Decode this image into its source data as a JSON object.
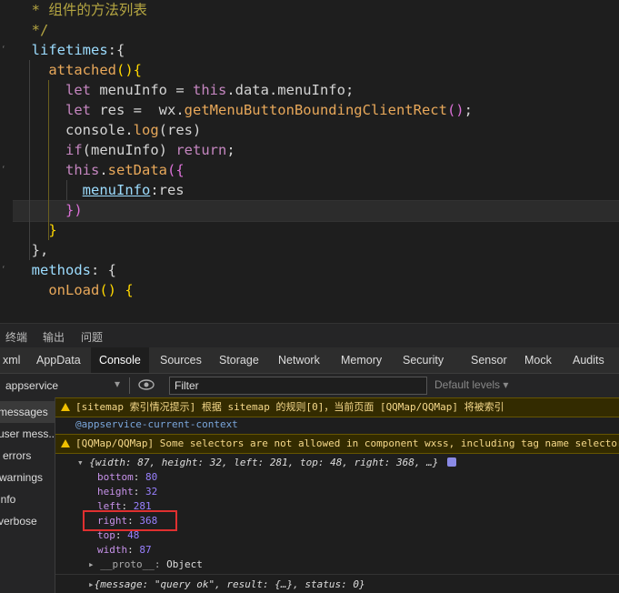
{
  "code": {
    "lines": [
      {
        "indent": "  ",
        "tokens": [
          {
            "t": "* 组件的方法列表",
            "c": "c-com"
          }
        ]
      },
      {
        "indent": "  ",
        "tokens": [
          {
            "t": "*/",
            "c": "c-com"
          }
        ]
      },
      {
        "indent": "  ",
        "tokens": [
          {
            "t": "lifetimes",
            "c": "c-prop"
          },
          {
            "t": ":{",
            "c": "c-plain"
          }
        ]
      },
      {
        "indent": "    ",
        "tokens": [
          {
            "t": "attached",
            "c": "c-or"
          },
          {
            "t": "(){",
            "c": "c-yel"
          }
        ]
      },
      {
        "indent": "      ",
        "tokens": [
          {
            "t": "let ",
            "c": "c-kw"
          },
          {
            "t": "menuInfo",
            "c": "c-plain"
          },
          {
            "t": " = ",
            "c": "c-plain"
          },
          {
            "t": "this",
            "c": "c-kw"
          },
          {
            "t": ".data.menuInfo;",
            "c": "c-plain"
          }
        ]
      },
      {
        "indent": "      ",
        "tokens": [
          {
            "t": "let ",
            "c": "c-kw"
          },
          {
            "t": "res",
            "c": "c-plain"
          },
          {
            "t": " =  wx.",
            "c": "c-plain"
          },
          {
            "t": "getMenuButtonBoundingClientRect",
            "c": "c-or"
          },
          {
            "t": "()",
            "c": "c-pink"
          },
          {
            "t": ";",
            "c": "c-plain"
          }
        ]
      },
      {
        "indent": "      ",
        "tokens": [
          {
            "t": "console.",
            "c": "c-plain"
          },
          {
            "t": "log",
            "c": "c-or"
          },
          {
            "t": "(res)",
            "c": "c-plain"
          }
        ]
      },
      {
        "indent": "      ",
        "tokens": [
          {
            "t": "if",
            "c": "c-kw"
          },
          {
            "t": "(menuInfo) ",
            "c": "c-plain"
          },
          {
            "t": "return",
            "c": "c-kw"
          },
          {
            "t": ";",
            "c": "c-plain"
          }
        ]
      },
      {
        "indent": "      ",
        "tokens": [
          {
            "t": "this",
            "c": "c-kw"
          },
          {
            "t": ".",
            "c": "c-plain"
          },
          {
            "t": "setData",
            "c": "c-or"
          },
          {
            "t": "({",
            "c": "c-pink"
          }
        ]
      },
      {
        "indent": "        ",
        "tokens": [
          {
            "t": "menuInfo",
            "c": "c-ul"
          },
          {
            "t": ":res",
            "c": "c-plain"
          }
        ]
      },
      {
        "indent": "      ",
        "tokens": [
          {
            "t": "})",
            "c": "c-pink"
          }
        ]
      },
      {
        "indent": "    ",
        "tokens": [
          {
            "t": "}",
            "c": "c-yel"
          }
        ]
      },
      {
        "indent": "  ",
        "tokens": [
          {
            "t": "},",
            "c": "c-plain"
          }
        ]
      },
      {
        "indent": "  ",
        "tokens": [
          {
            "t": "methods",
            "c": "c-prop"
          },
          {
            "t": ": {",
            "c": "c-plain"
          }
        ]
      },
      {
        "indent": "    ",
        "tokens": [
          {
            "t": "onLoad",
            "c": "c-or"
          },
          {
            "t": "() {",
            "c": "c-yel"
          }
        ]
      }
    ]
  },
  "panel": {
    "tab1": "终端",
    "tab2": "输出",
    "tab3": "问题"
  },
  "devtools": {
    "tabs": [
      "xml",
      "AppData",
      "Console",
      "Sources",
      "Storage",
      "Network",
      "Memory",
      "Security",
      "Sensor",
      "Mock",
      "Audits"
    ],
    "active_tab": "Console",
    "context": "appservice",
    "filter_placeholder": "Filter",
    "levels": "Default levels"
  },
  "sidebar": [
    "messages",
    "user mess...",
    "errors",
    "warnings",
    "info",
    "verbose"
  ],
  "console": {
    "warn1": "[sitemap 索引情况提示] 根据 sitemap 的规则[0]，当前页面 [QQMap/QQMap] 将被索引",
    "context_link": "@appservice-current-context",
    "warn2": "[QQMap/QQMap] Some selectors are not allowed in component wxss, including tag name selectors",
    "summary": "{width: 87, height: 32, left: 281, top: 48, right: 368, …}",
    "props": [
      {
        "k": "bottom",
        "v": "80"
      },
      {
        "k": "height",
        "v": "32"
      },
      {
        "k": "left",
        "v": "281"
      },
      {
        "k": "right",
        "v": "368"
      },
      {
        "k": "top",
        "v": "48"
      },
      {
        "k": "width",
        "v": "87"
      }
    ],
    "proto_key": "__proto__",
    "proto_val": "Object",
    "last_obj": "{message: \"query ok\", result: {…}, status: 0}"
  },
  "highlight_color": "#e03030"
}
